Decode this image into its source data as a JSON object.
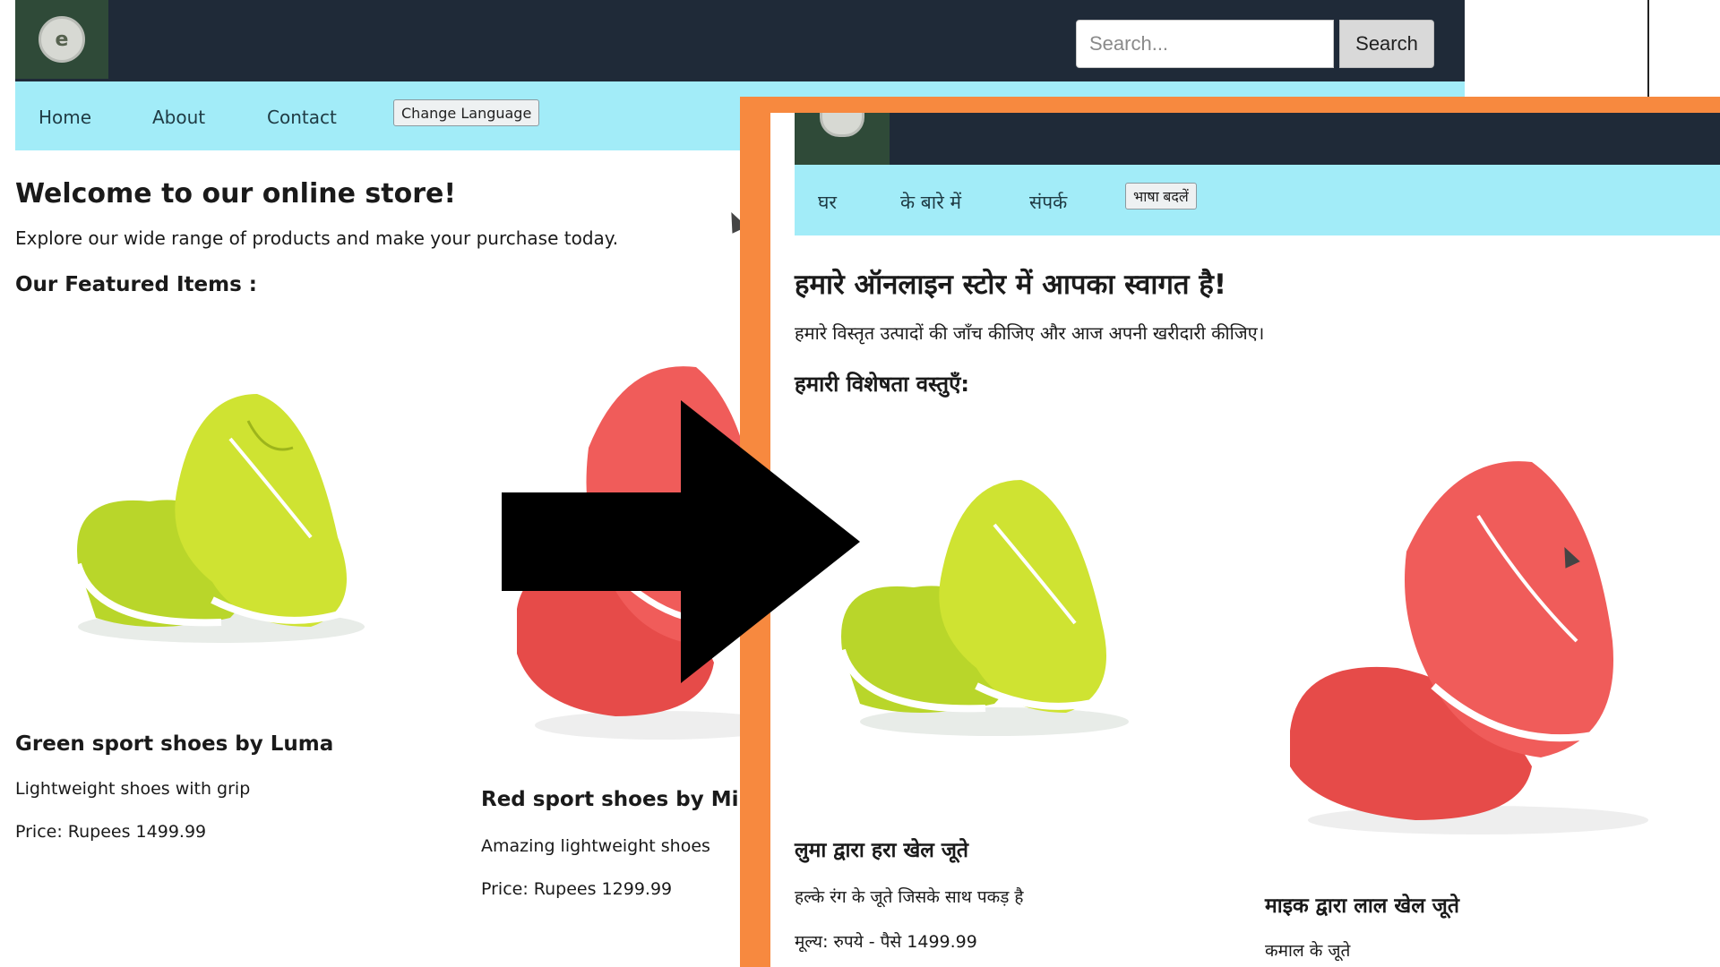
{
  "left": {
    "search": {
      "placeholder": "Search...",
      "button": "Search"
    },
    "nav": {
      "items": [
        "Home",
        "About",
        "Contact"
      ],
      "change_language": "Change Language"
    },
    "welcome": "Welcome to our online store!",
    "intro": "Explore our wide range of products and make your purchase today.",
    "featured": "Our Featured Items :",
    "products": [
      {
        "name": "Green sport shoes by Luma",
        "description": "Lightweight shoes with grip",
        "price": "Price: Rupees 1499.99",
        "color": "#c6e02a"
      },
      {
        "name": "Red sport shoes by Mi",
        "description": "Amazing lightweight shoes",
        "price": "Price: Rupees 1299.99",
        "color": "#ef5a57"
      }
    ]
  },
  "right": {
    "nav": {
      "items": [
        "घर",
        "के बारे में",
        "संपर्क"
      ],
      "change_language": "भाषा बदलें"
    },
    "welcome": "हमारे ऑनलाइन स्टोर में आपका स्वागत है!",
    "intro": "हमारे विस्तृत उत्पादों की जाँच कीजिए और आज अपनी खरीदारी कीजिए।",
    "featured": "हमारी विशेषता वस्तुएँ:",
    "products": [
      {
        "name": "लुमा द्वारा हरा खेल जूते",
        "description": "हल्के रंग के जूते जिसके साथ पकड़ है",
        "price": "मूल्य: रुपये - पैसे 1499.99",
        "color": "#c6e02a"
      },
      {
        "name": "माइक द्वारा लाल खेल जूते",
        "description": "कमाल के जूते",
        "color": "#ef5a57"
      }
    ]
  },
  "colors": {
    "topbar": "#1f2a38",
    "navbar": "#a2ecf8",
    "frame": "#f7893f",
    "arrow": "#000000"
  }
}
